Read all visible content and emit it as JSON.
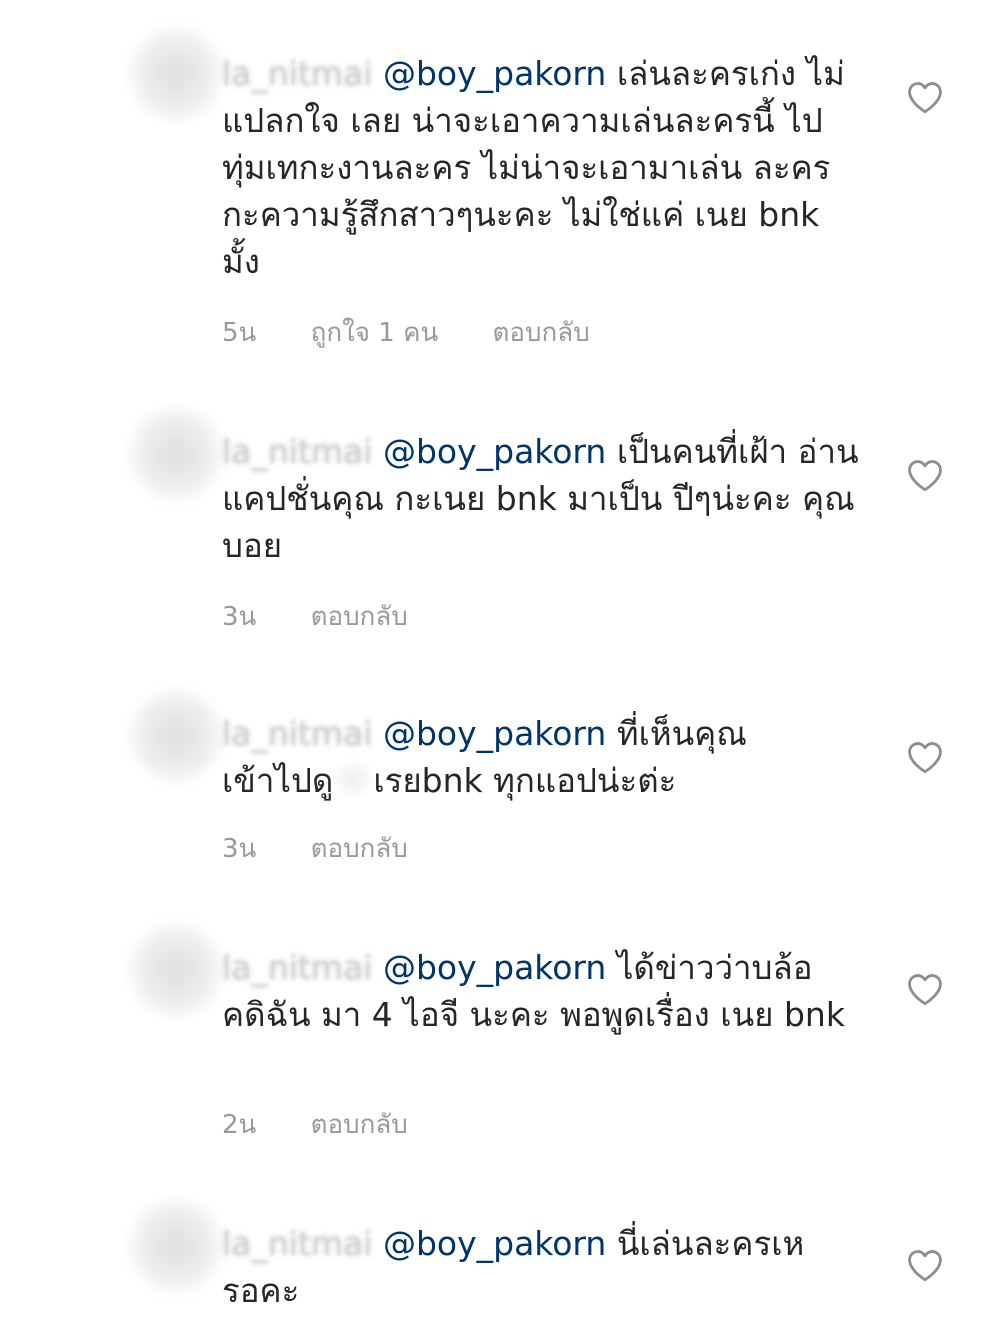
{
  "comments": [
    {
      "username": "la_nitmai",
      "mention": "@boy_pakorn",
      "text": "เล่นละครเก่ง ไม่แปลกใจ เลย น่าจะเอาความเล่นละครนี้ ไปทุ่มเทกะงานละคร ไม่น่าจะเอามาเล่น ละครกะความรู้สึกสาวๆนะคะ ไม่ใช่แค่ เนย bnk มั้ง",
      "time": "5น",
      "likes": "ถูกใจ 1 คน",
      "reply": "ตอบกลับ"
    },
    {
      "username": "la_nitmai",
      "mention": "@boy_pakorn",
      "text": "เป็นคนที่เฝ้า อ่าน แคปชั่นคุณ กะเนย bnk มาเป็น ปีๆน่ะคะ คุณบอย",
      "time": "3น",
      "reply": "ตอบกลับ"
    },
    {
      "username": "la_nitmai",
      "mention": "@boy_pakorn",
      "text": "ที่เห็นคุณ",
      "text_line2_a": "เข้าไปดู",
      "text_line2_b": "เรยbnk ทุกแอปน่ะต่ะ",
      "time": "3น",
      "reply": "ตอบกลับ"
    },
    {
      "username": "la_nitmai",
      "mention": "@boy_pakorn",
      "text": "ได้ข่าวว่าบล้อ คดิฉัน มา 4 ไอจี นะคะ พอพูดเรื่อง เนย bnk",
      "time": "2น",
      "reply": "ตอบกลับ"
    },
    {
      "username": "la_nitmai",
      "mention": "@boy_pakorn",
      "text": "นี่เล่นละครเห รอคะ"
    }
  ],
  "icons": {
    "like": "heart-outline-icon"
  },
  "colors": {
    "mention": "#003569",
    "text": "#262626",
    "meta": "#999999",
    "icon": "#8e8e8e"
  }
}
